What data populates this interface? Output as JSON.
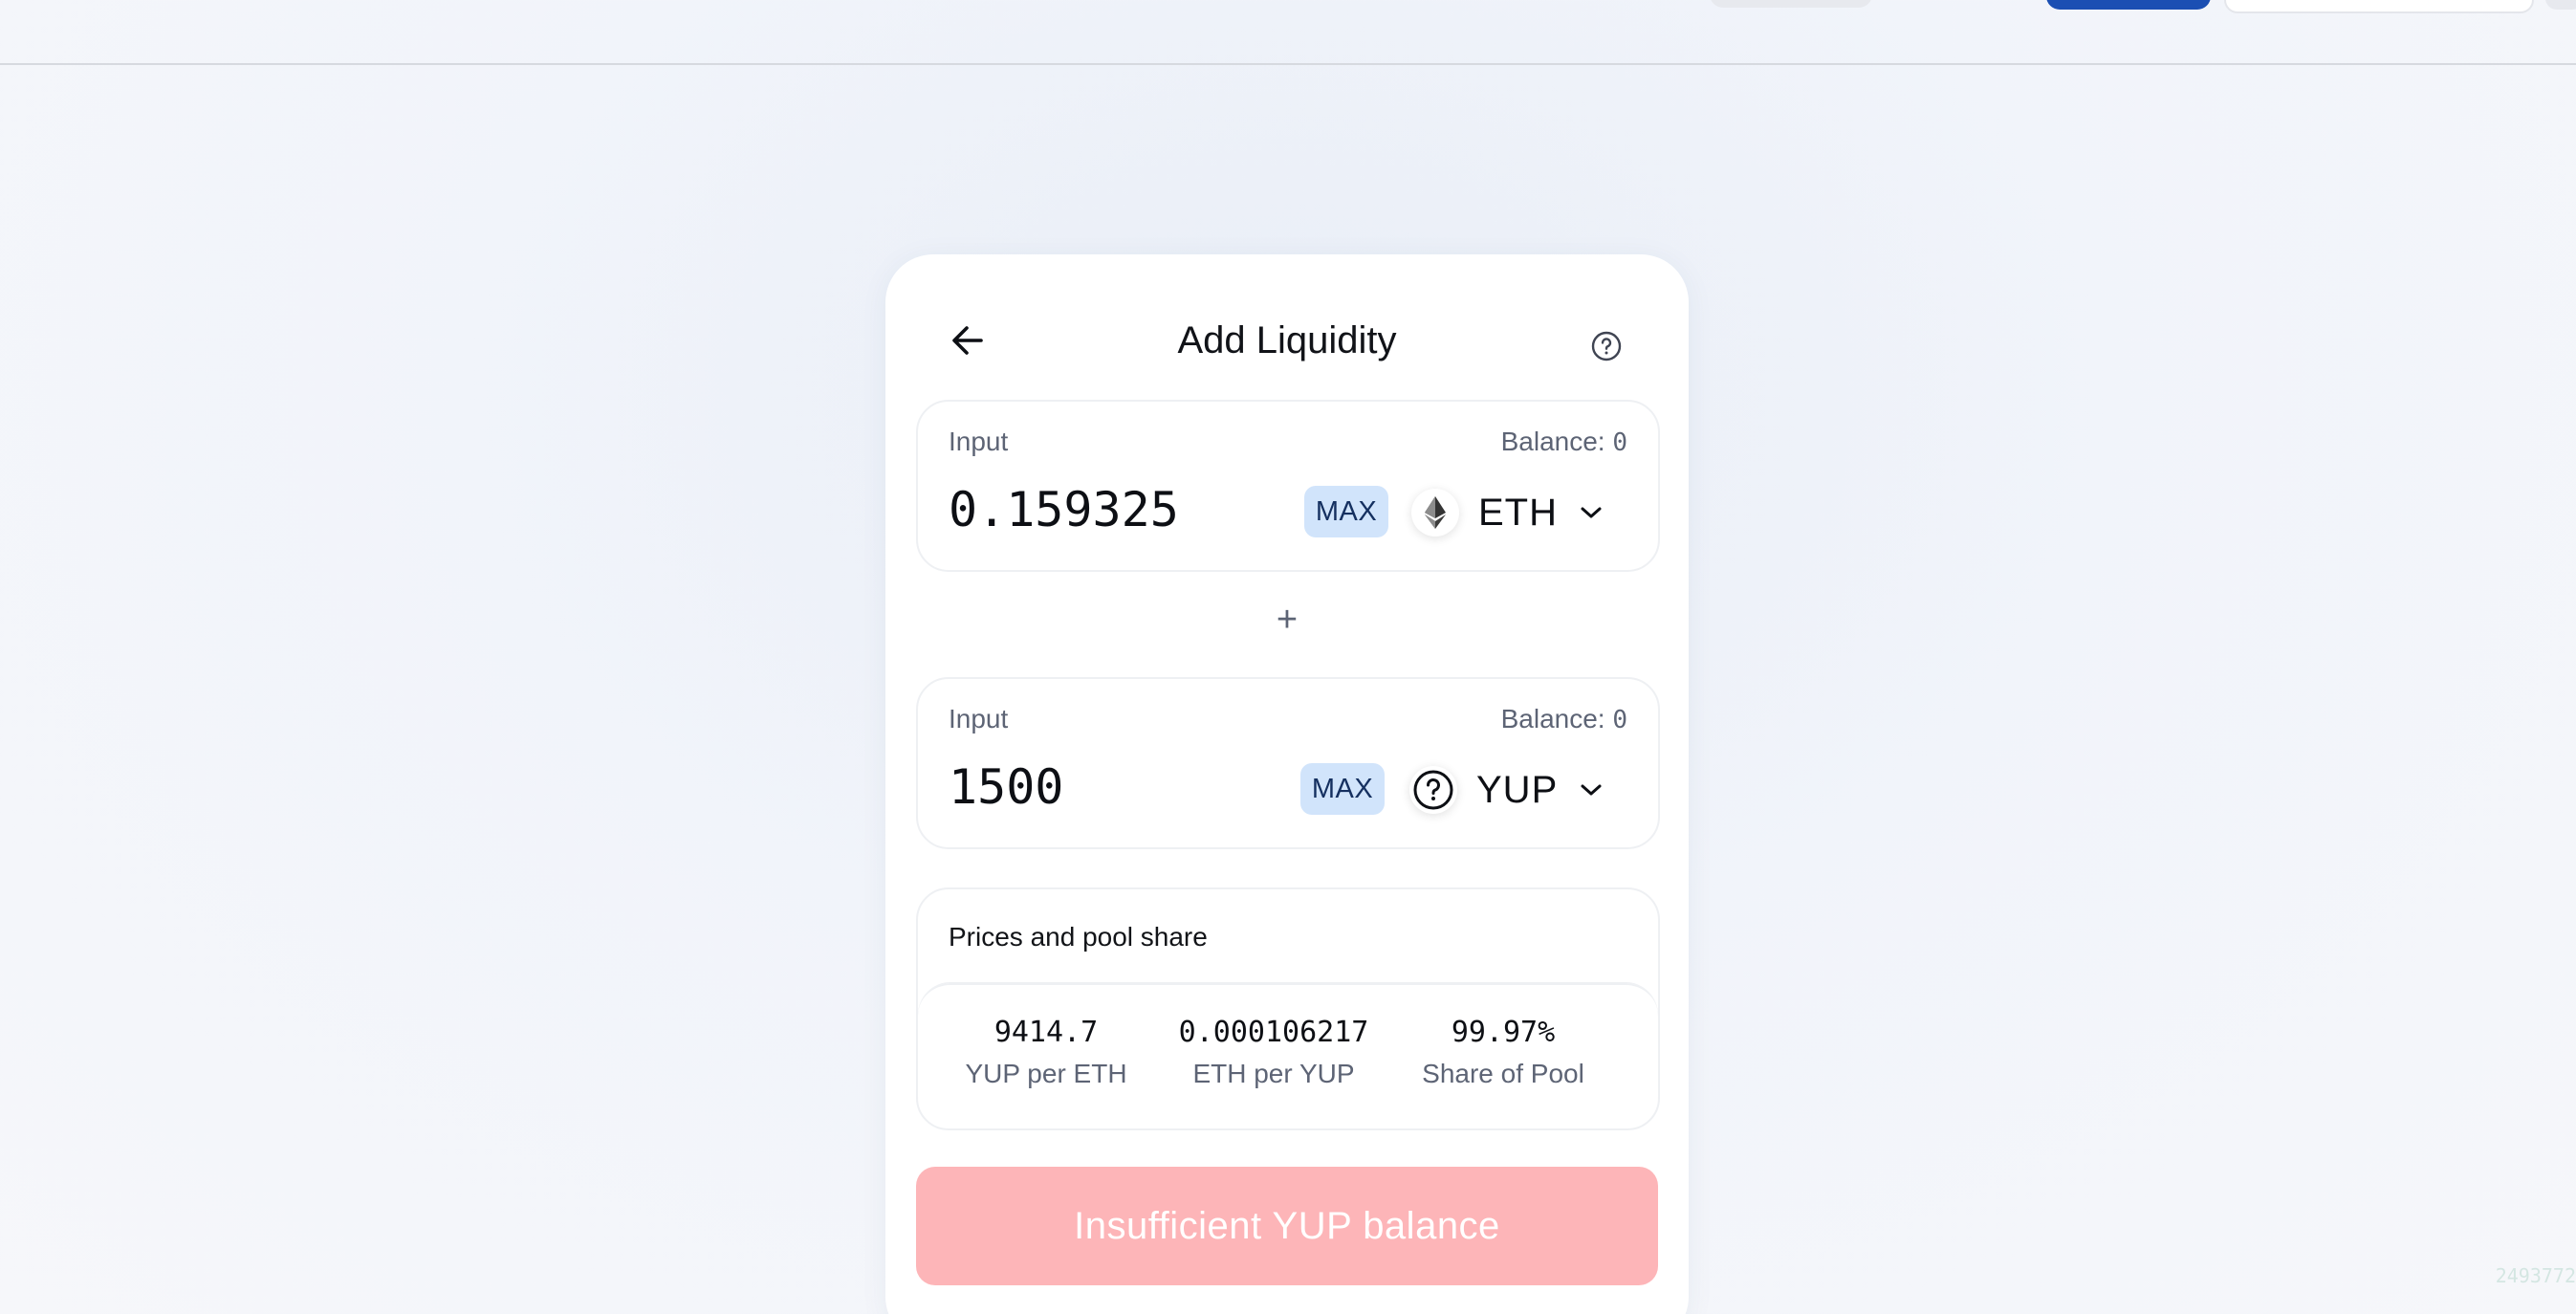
{
  "header": {
    "title": "Add Liquidity"
  },
  "input_a": {
    "label": "Input",
    "balance_label": "Balance:",
    "balance_value": "0",
    "amount": "0.159325",
    "max_label": "MAX",
    "token": "ETH",
    "token_icon": "ethereum-icon"
  },
  "plus_symbol": "+",
  "input_b": {
    "label": "Input",
    "balance_label": "Balance:",
    "balance_value": "0",
    "amount": "1500",
    "max_label": "MAX",
    "token": "YUP",
    "token_icon": "unknown-token-icon"
  },
  "prices": {
    "title": "Prices and pool share",
    "stats": [
      {
        "value": "9414.7",
        "label": "YUP per ETH"
      },
      {
        "value": "0.000106217",
        "label": "ETH per YUP"
      },
      {
        "value": "99.97%",
        "label": "Share of Pool"
      }
    ]
  },
  "submit": {
    "label": "Insufficient YUP balance",
    "color": "#fdb5b8"
  },
  "footer": {
    "id": "2493772"
  },
  "colors": {
    "max_bg": "#d1e4fb",
    "accent_blue": "#1b4fb3"
  }
}
